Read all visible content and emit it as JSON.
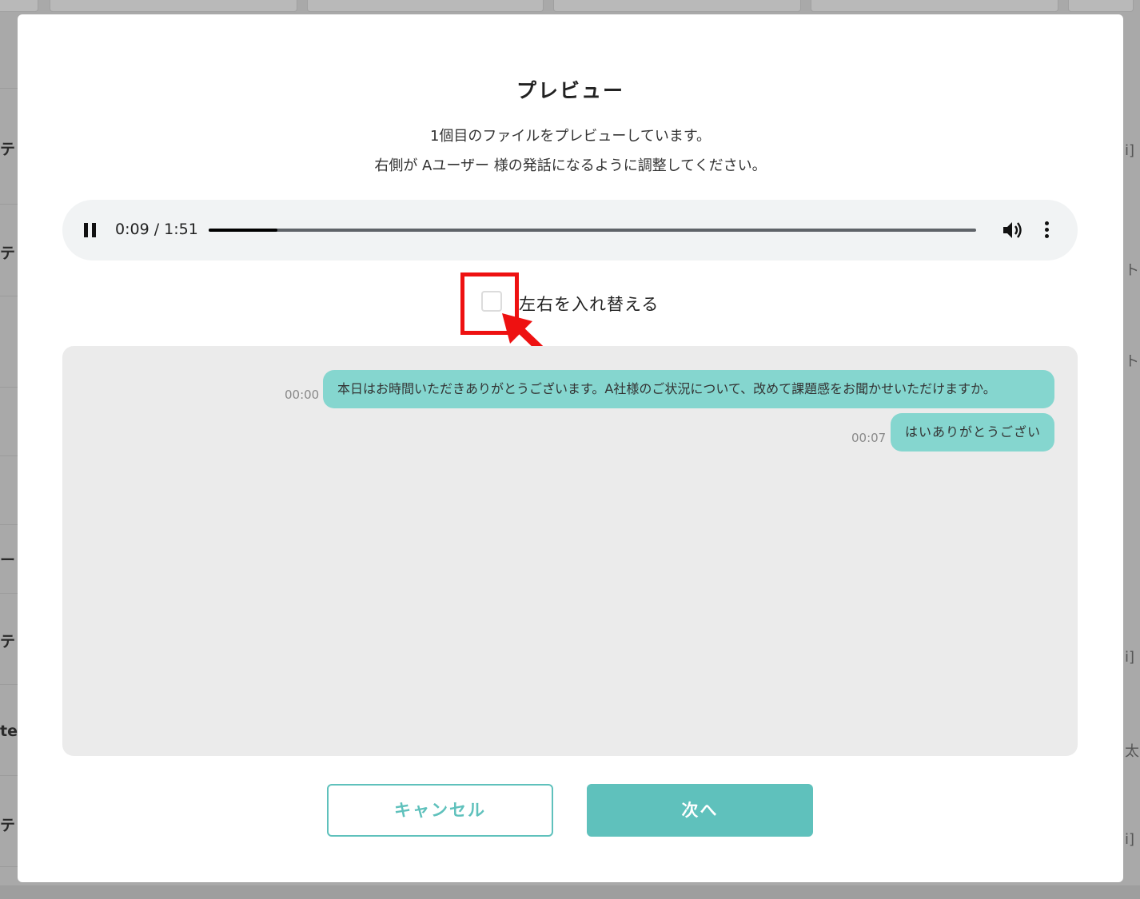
{
  "background": {
    "left_fragments": [
      "テ",
      "テ",
      "ー",
      "テ",
      "te",
      "テ"
    ],
    "right_fragments": [
      "i]",
      "ト",
      "ト",
      "i]",
      "太",
      "i]"
    ]
  },
  "modal": {
    "title": "プレビュー",
    "description_line1": "1個目のファイルをプレビューしています。",
    "description_line2": "右側が Aユーザー 様の発話になるように調整してください。"
  },
  "player": {
    "current_time": "0:09",
    "duration": "1:51",
    "time_display": "0:09 / 1:51",
    "progress_fraction": 0.09
  },
  "swap": {
    "label": "左右を入れ替える",
    "checked": false
  },
  "transcript": [
    {
      "time": "00:00",
      "text": "本日はお時間いただきありがとうございます。A社様のご状況について、改めて課題感をお聞かせいただけますか。"
    },
    {
      "time": "00:07",
      "text": "はいありがとうござい"
    }
  ],
  "buttons": {
    "cancel": "キャンセル",
    "next": "次へ"
  },
  "colors": {
    "accent": "#5fc1bc",
    "bubble": "#85d6cf",
    "highlight": "#ee1111"
  }
}
